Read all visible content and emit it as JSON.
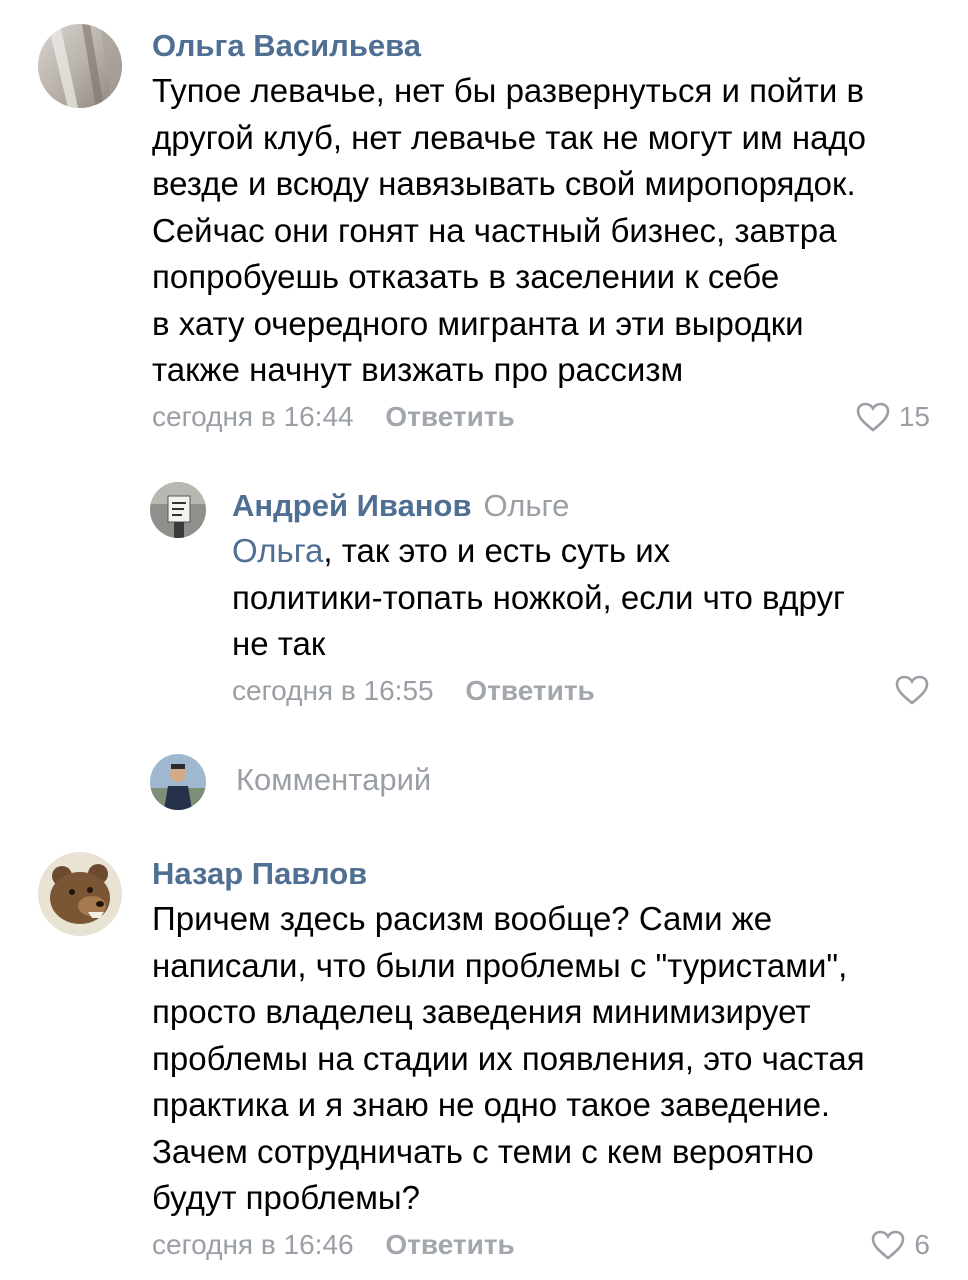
{
  "comments": [
    {
      "author": "Ольга Васильева",
      "text": "Тупое левачье, нет бы развернуться и пойти в\nдругой клуб, нет левачье так не могут им надо\nвезде и всюду навязывать свой миропорядок.\nСейчас они гонят на частный бизнес, завтра\nпопробуешь отказать в заселении к себе\nв хату очередного мигранта и эти выродки\nтакже начнут визжать про рассизм",
      "time": "сегодня в 16:44",
      "reply_label": "Ответить",
      "likes": "15",
      "avatar_icon": "photo-avatar-icon"
    },
    {
      "author": "Андрей Иванов",
      "reply_to": "Ольге",
      "mention": "Ольга",
      "text": ", так это и есть суть их\nполитики-топать ножкой, если что вдруг\nне так",
      "time": "сегодня в 16:55",
      "reply_label": "Ответить",
      "likes": "",
      "avatar_icon": "photo-avatar-icon"
    },
    {
      "author": "Назар Павлов",
      "text": "Причем здесь расизм вообще? Сами же\nнаписали, что были проблемы с \"туристами\",\nпросто владелец заведения минимизирует\nпроблемы на стадии их появления, это частая\nпрактика и я знаю не одно такое заведение.\nЗачем сотрудничать с теми с кем вероятно\nбудут проблемы?",
      "time": "сегодня в 16:46",
      "reply_label": "Ответить",
      "likes": "6",
      "avatar_icon": "bear-avatar-icon"
    }
  ],
  "compose": {
    "placeholder": "Комментарий",
    "avatar_icon": "user-avatar-icon"
  },
  "colors": {
    "author": "#4f6f93",
    "meta": "#9a9fa6",
    "text": "#000000",
    "background": "#ffffff"
  }
}
